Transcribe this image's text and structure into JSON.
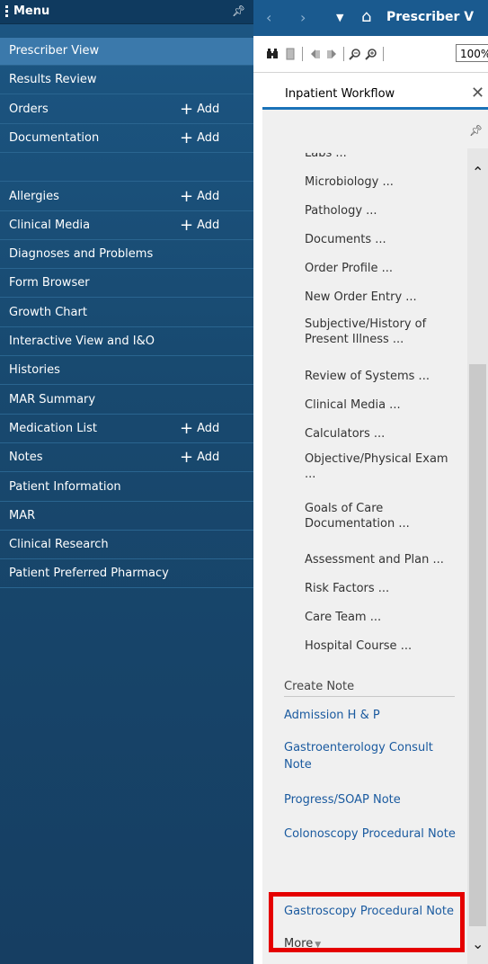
{
  "menu": {
    "title": "Menu",
    "items": [
      {
        "label": "Prescriber View",
        "add": ""
      },
      {
        "label": "Results Review",
        "add": ""
      },
      {
        "label": "Orders",
        "add": "Add"
      },
      {
        "label": "Documentation",
        "add": "Add"
      },
      {
        "label": "",
        "add": ""
      },
      {
        "label": "Allergies",
        "add": "Add"
      },
      {
        "label": "Clinical Media",
        "add": "Add"
      },
      {
        "label": "Diagnoses and Problems",
        "add": ""
      },
      {
        "label": "Form Browser",
        "add": ""
      },
      {
        "label": "Growth Chart",
        "add": ""
      },
      {
        "label": "Interactive View and I&O",
        "add": ""
      },
      {
        "label": "Histories",
        "add": ""
      },
      {
        "label": "MAR Summary",
        "add": ""
      },
      {
        "label": "Medication List",
        "add": "Add"
      },
      {
        "label": "Notes",
        "add": "Add"
      },
      {
        "label": "Patient Information",
        "add": ""
      },
      {
        "label": "MAR",
        "add": ""
      },
      {
        "label": "Clinical Research",
        "add": ""
      },
      {
        "label": "Patient Preferred Pharmacy",
        "add": ""
      }
    ]
  },
  "topbar": {
    "title": "Prescriber V"
  },
  "toolbar": {
    "zoom": "100%"
  },
  "workflow": {
    "tab_label": "Inpatient Workflow",
    "items": [
      "Labs ...",
      "Microbiology ...",
      "Pathology ...",
      "Documents ...",
      "Order Profile ...",
      "New Order Entry ...",
      "Subjective/History of Present Illness ...",
      "Review of Systems ...",
      "Clinical Media ...",
      "Calculators ...",
      "Objective/Physical Exam ...",
      "Goals of Care Documentation ...",
      "Assessment and Plan ...",
      "Risk Factors ...",
      "Care Team ...",
      "Hospital Course ..."
    ],
    "create_note_header": "Create Note",
    "notes": [
      "Admission H & P",
      "Gastroenterology Consult Note",
      "Progress/SOAP Note",
      "Colonoscopy Procedural Note",
      "Gastroscopy Procedural Note"
    ],
    "more_label": "More"
  },
  "colors": {
    "menu_bg": "#18496f",
    "selected_bg": "#3b79ab",
    "link": "#1a5a9f",
    "highlight": "#e50000",
    "tab_underline": "#1a73b8"
  }
}
